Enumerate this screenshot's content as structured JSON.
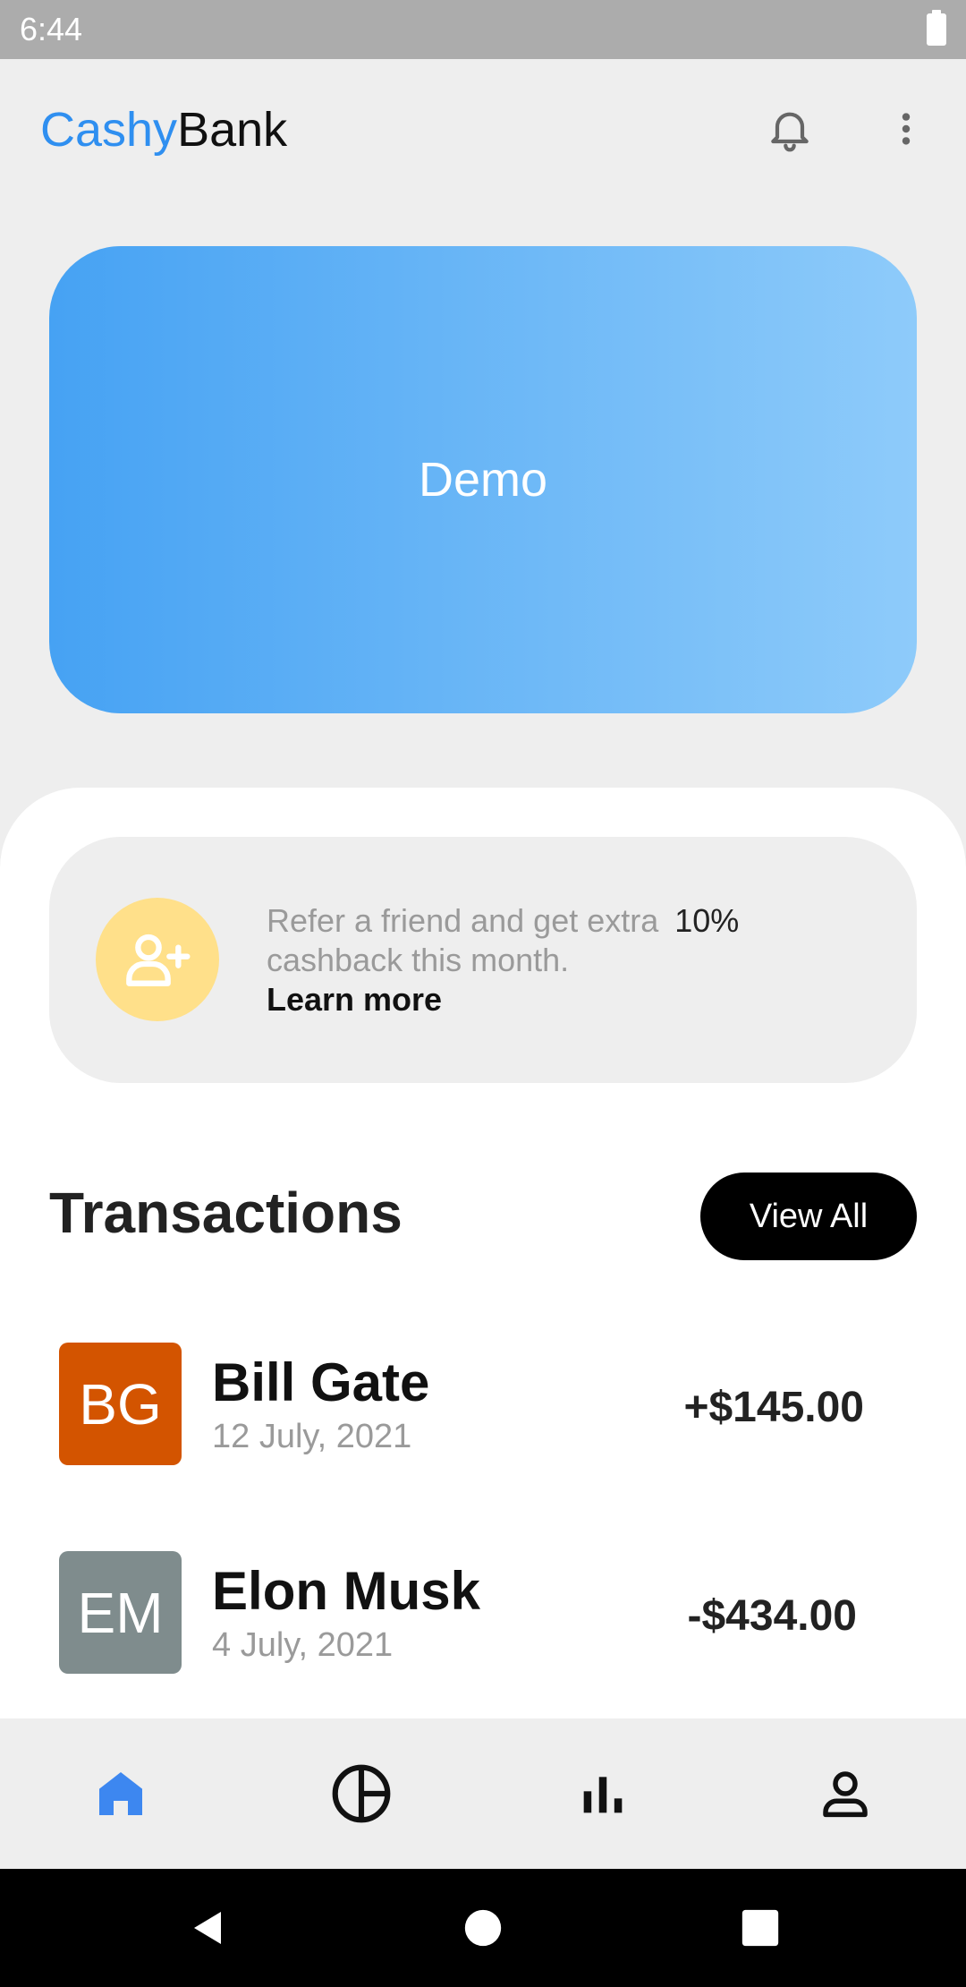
{
  "status_bar": {
    "time": "6:44"
  },
  "app": {
    "brand_part1": "Cashy",
    "brand_part2": "Bank"
  },
  "card": {
    "label": "Demo"
  },
  "promo": {
    "text": "Refer a friend and get extra",
    "percent": "10%",
    "text2": "cashback this month.",
    "link": "Learn more"
  },
  "transactions": {
    "title": "Transactions",
    "view_all": "View All",
    "items": [
      {
        "initials": "BG",
        "name": "Bill Gate",
        "date": "12 July, 2021",
        "amount": "+$145.00",
        "color": "#d35400"
      },
      {
        "initials": "EM",
        "name": "Elon Musk",
        "date": "4 July, 2021",
        "amount": "-$434.00",
        "color": "#7f8c8d"
      }
    ]
  },
  "colors": {
    "brand_blue": "#2f8ff0",
    "active_nav": "#3d87f0"
  }
}
